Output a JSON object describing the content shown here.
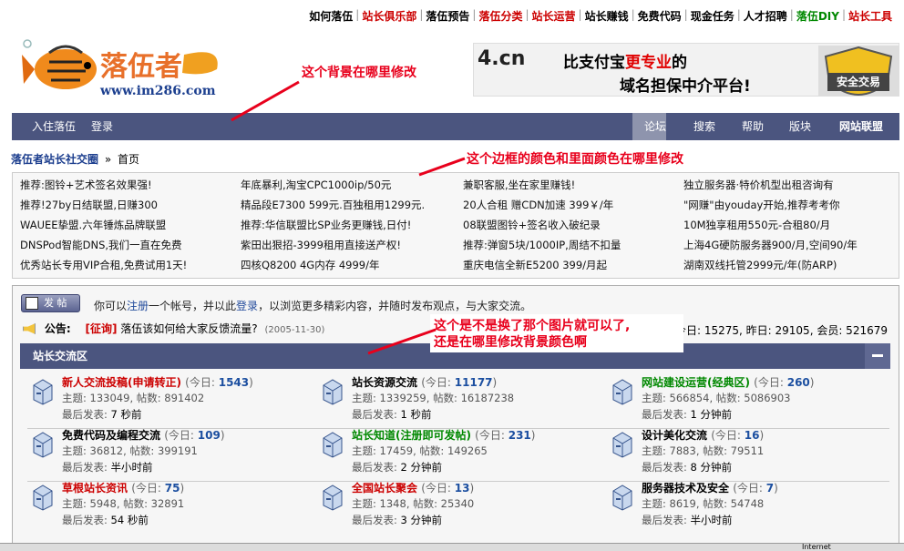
{
  "top_links": [
    {
      "label": "如何落伍",
      "color": "#000000"
    },
    {
      "label": "站长俱乐部",
      "color": "#cc0000"
    },
    {
      "label": "落伍预告",
      "color": "#000000"
    },
    {
      "label": "落伍分类",
      "color": "#cc0000"
    },
    {
      "label": "站长运营",
      "color": "#cc0000"
    },
    {
      "label": "站长赚钱",
      "color": "#000000"
    },
    {
      "label": "免费代码",
      "color": "#000000"
    },
    {
      "label": "现金任务",
      "color": "#000000"
    },
    {
      "label": "人才招聘",
      "color": "#000000"
    },
    {
      "label": "落伍DIY",
      "color": "#008800"
    },
    {
      "label": "站长工具",
      "color": "#cc0000"
    }
  ],
  "logo": {
    "name": "落伍者",
    "url": "www.im286.com"
  },
  "banner": {
    "domain": "4.cn",
    "line1_a": "比支付宝",
    "line1_b": "更专业",
    "line1_c": "的",
    "line2": "域名担保中介平台!",
    "badge": "安全交易"
  },
  "nav": {
    "left": [
      "入住落伍",
      "登录"
    ],
    "right": [
      "论坛",
      "搜索",
      "帮助",
      "版块",
      "网站联盟"
    ]
  },
  "breadcrumb": {
    "home": "落伍者站长社交圈",
    "sep": "»",
    "current": "首页"
  },
  "ads": [
    [
      "推荐:图铃+艺术签名效果强!",
      "年底暴利,淘宝CPC1000ip/50元",
      "兼职客服,坐在家里赚钱!",
      "独立服务器·特价机型出租咨询有"
    ],
    [
      "推荐!27by日结联盟,日赚300",
      "精品段E7300 599元.百独租用1299元.",
      "20人合租 赠CDN加速  399￥/年",
      "\"网赚\"由youday开始,推荐考考你"
    ],
    [
      "WAUEE挚盟.六年锤炼品牌联盟",
      "推荐:华信联盟比SP业务更赚钱,日付!",
      "08联盟图铃+签名收入破纪录",
      "10M独享租用550元-合租80/月"
    ],
    [
      "DNSPod智能DNS,我们一直在免费",
      "紫田出狠招-3999租用直接送产权!",
      "推荐:弹窗5块/1000IP,周结不扣量",
      "上海4G硬防服务器900/月,空间90/年"
    ],
    [
      "优秀站长专用VIP合租,免费试用1天!",
      "四核Q8200 4G内存  4999/年",
      "重庆电信全新E5200 399/月起",
      "湖南双线托管2999元/年(防ARP)"
    ]
  ],
  "post_button": "发 帖",
  "welcome": {
    "a": "你可以",
    "b": "注册",
    "c": "一个帐号，并以此",
    "d": "登录",
    "e": "，以浏览更多精彩内容，并随时发布观点，与大家交流。"
  },
  "announcement": {
    "label": "公告:",
    "tag": "[征询]",
    "text": "落伍该如何给大家反馈流量?",
    "date": "(2005-11-30)"
  },
  "stats": "今日: 15275, 昨日: 29105, 会员: 521679",
  "section_title": "站长交流区",
  "forums": [
    {
      "name": "新人交流投稿(申请转正)",
      "color": "#cc0000",
      "today": "1543",
      "topics": "133049",
      "posts": "891402",
      "last": "7 秒前"
    },
    {
      "name": "站长资源交流",
      "color": "#000000",
      "today": "11177",
      "topics": "1339259",
      "posts": "16187238",
      "last": "1 秒前"
    },
    {
      "name": "网站建设运营(经典区)",
      "color": "#008800",
      "today": "260",
      "topics": "566854",
      "posts": "5086903",
      "last": "1 分钟前"
    },
    {
      "name": "免费代码及编程交流",
      "color": "#000000",
      "today": "109",
      "topics": "36812",
      "posts": "399191",
      "last": "半小时前"
    },
    {
      "name": "站长知道(注册即可发帖)",
      "color": "#008800",
      "today": "231",
      "topics": "17459",
      "posts": "149265",
      "last": "2 分钟前"
    },
    {
      "name": "设计美化交流",
      "color": "#000000",
      "today": "16",
      "topics": "7883",
      "posts": "79511",
      "last": "8 分钟前"
    },
    {
      "name": "草根站长资讯",
      "color": "#cc0000",
      "today": "75",
      "topics": "5948",
      "posts": "32891",
      "last": "54 秒前"
    },
    {
      "name": "全国站长聚会",
      "color": "#cc0000",
      "today": "13",
      "topics": "1348",
      "posts": "25340",
      "last": "3 分钟前"
    },
    {
      "name": "服务器技术及安全",
      "color": "#000000",
      "today": "7",
      "topics": "8619",
      "posts": "54748",
      "last": "半小时前"
    }
  ],
  "labels": {
    "today": "(今日:",
    "topics": "主题:",
    "posts": "帖数:",
    "last": "最后发表:"
  },
  "notes": {
    "n1": "这个背景在哪里修改",
    "n2": "这个边框的颜色和里面颜色在哪里修改",
    "n3a": "这个是不是换了那个图片就可以了,",
    "n3b": "还是在哪里修改背景颜色啊"
  },
  "status": {
    "zone": "Internet"
  }
}
